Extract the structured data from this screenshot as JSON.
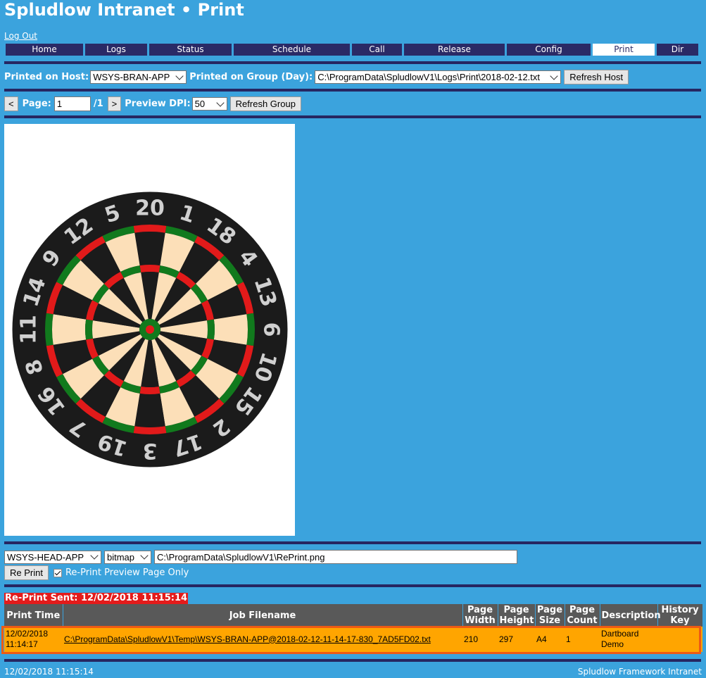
{
  "header": {
    "title": "Spludlow Intranet • Print",
    "logout": "Log Out"
  },
  "nav": [
    {
      "label": "Home"
    },
    {
      "label": "Logs"
    },
    {
      "label": "Status"
    },
    {
      "label": "Schedule"
    },
    {
      "label": "Call"
    },
    {
      "label": "Release"
    },
    {
      "label": "Config"
    },
    {
      "label": "Print",
      "active": true
    },
    {
      "label": "Dir"
    }
  ],
  "host_row": {
    "host_label": "Printed on Host:",
    "host_value": "WSYS-BRAN-APP",
    "group_label": "Printed on Group (Day):",
    "group_value": "C:\\ProgramData\\SpludlowV1\\Logs\\Print\\2018-02-12.txt",
    "refresh_host": "Refresh Host"
  },
  "page_row": {
    "prev": "<",
    "page_label": "Page:",
    "page_value": "1",
    "page_total": "/1",
    "next": ">",
    "dpi_label": "Preview DPI:",
    "dpi_value": "50",
    "refresh_group": "Refresh Group"
  },
  "dartboard": {
    "numbers": [
      "20",
      "1",
      "18",
      "4",
      "13",
      "6",
      "10",
      "15",
      "2",
      "17",
      "3",
      "19",
      "7",
      "16",
      "8",
      "11",
      "14",
      "9",
      "12",
      "5"
    ],
    "colors": {
      "black": "#1b1b1b",
      "cream": "#fcdfb8",
      "red": "#e21a1a",
      "green": "#117a1d",
      "number": "#d0d0d0"
    }
  },
  "reprint": {
    "host_value": "WSYS-HEAD-APP",
    "format_value": "bitmap",
    "path_value": "C:\\ProgramData\\SpludlowV1\\RePrint.png",
    "button": "Re Print",
    "checkbox_label": "Re-Print Preview Page Only",
    "checked": true,
    "sent_banner": "Re-Print Sent: 12/02/2018 11:15:14"
  },
  "jobs_table": {
    "columns": [
      "Print Time",
      "Job Filename",
      "Page Width",
      "Page Height",
      "Page Size",
      "Page Count",
      "Description",
      "History Key"
    ],
    "rows": [
      {
        "print_time": "12/02/2018 11:14:17",
        "filename": "C:\\ProgramData\\SpludlowV1\\Temp\\WSYS-BRAN-APP@2018-02-12-11-14-17-830_7AD5FD02.txt",
        "width": "210",
        "height": "297",
        "size": "A4",
        "count": "1",
        "description": "Dartboard Demo",
        "history_key": ""
      }
    ]
  },
  "footer": {
    "left": "12/02/2018 11:15:14",
    "right": "Spludlow Framework Intranet"
  }
}
